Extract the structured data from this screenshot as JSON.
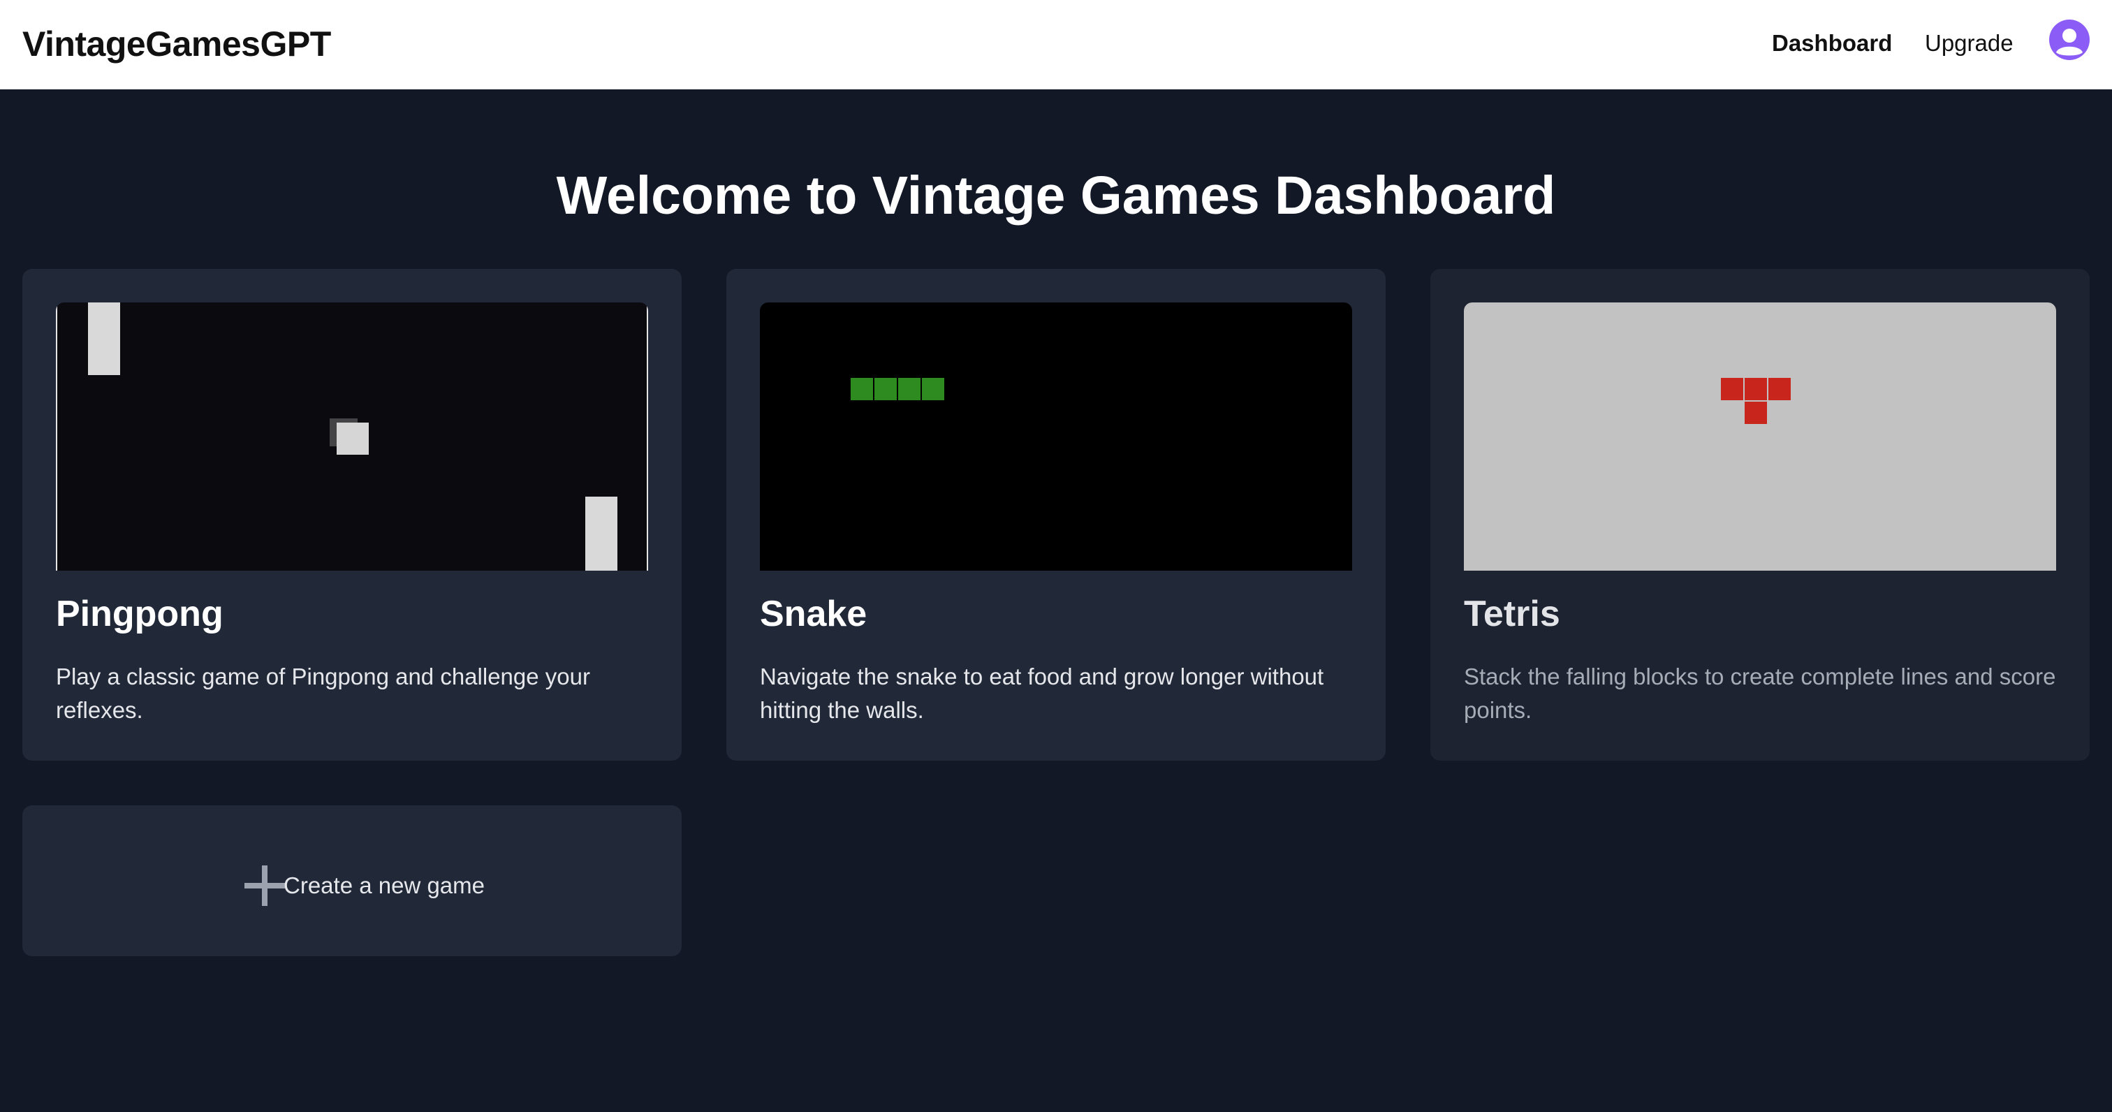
{
  "navbar": {
    "brand": "VintageGamesGPT",
    "links": [
      {
        "label": "Dashboard",
        "active": true
      },
      {
        "label": "Upgrade",
        "active": false
      }
    ],
    "avatar_icon": "user-avatar-icon",
    "avatar_color": "#8b5cf6"
  },
  "main": {
    "title": "Welcome to Vintage Games Dashboard",
    "games": [
      {
        "title": "Pingpong",
        "description": "Play a classic game of Pingpong and challenge your reflexes.",
        "thumbnail_icon": "pingpong-preview"
      },
      {
        "title": "Snake",
        "description": "Navigate the snake to eat food and grow longer without hitting the walls.",
        "thumbnail_icon": "snake-preview"
      },
      {
        "title": "Tetris",
        "description": "Stack the falling blocks to create complete lines and score points.",
        "thumbnail_icon": "tetris-preview"
      }
    ],
    "create": {
      "label": "Create a new game",
      "icon": "plus-icon"
    }
  },
  "colors": {
    "page_background": "#131826",
    "card_background": "#212838",
    "navbar_background": "#ffffff",
    "snake_green": "#2e8b1f",
    "tetris_red": "#c8261c"
  }
}
